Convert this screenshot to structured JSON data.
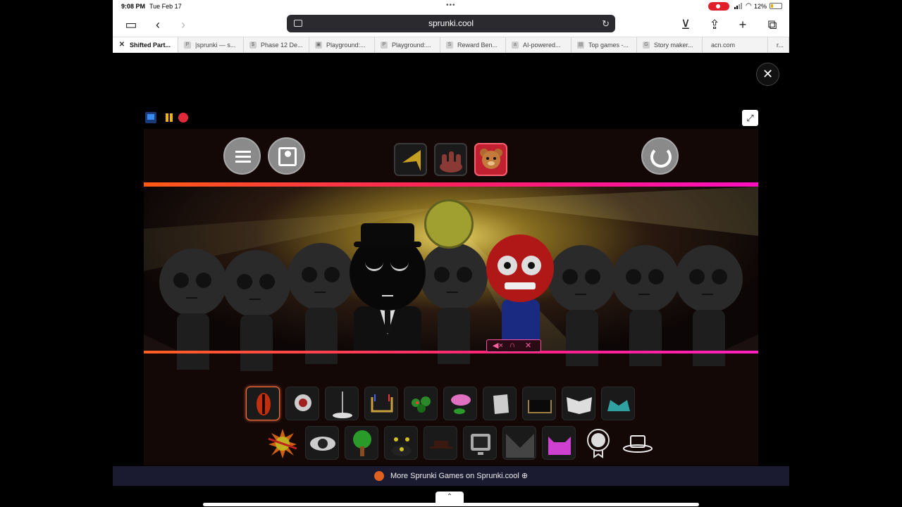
{
  "status": {
    "time": "9:08 PM",
    "date": "Tue Feb 17",
    "battery": "12%"
  },
  "browser": {
    "url": "sprunki.cool",
    "tabs": [
      {
        "label": "Shifted Part...",
        "active": true
      },
      {
        "label": "|sprunki — s..."
      },
      {
        "label": "Phase 12 De..."
      },
      {
        "label": "Playground:..."
      },
      {
        "label": "Playground:..."
      },
      {
        "label": "Reward Ben..."
      },
      {
        "label": "AI-powered..."
      },
      {
        "label": "Top games -..."
      },
      {
        "label": "Story maker..."
      },
      {
        "label": "acn.com"
      },
      {
        "label": "r..."
      }
    ]
  },
  "footer": {
    "more_games": "More Sprunki Games on Sprunki.cool ⊕"
  },
  "colors": {
    "accent_orange": "#ff5a14",
    "accent_pink": "#ff10c0",
    "stage_bg": "#140806"
  }
}
